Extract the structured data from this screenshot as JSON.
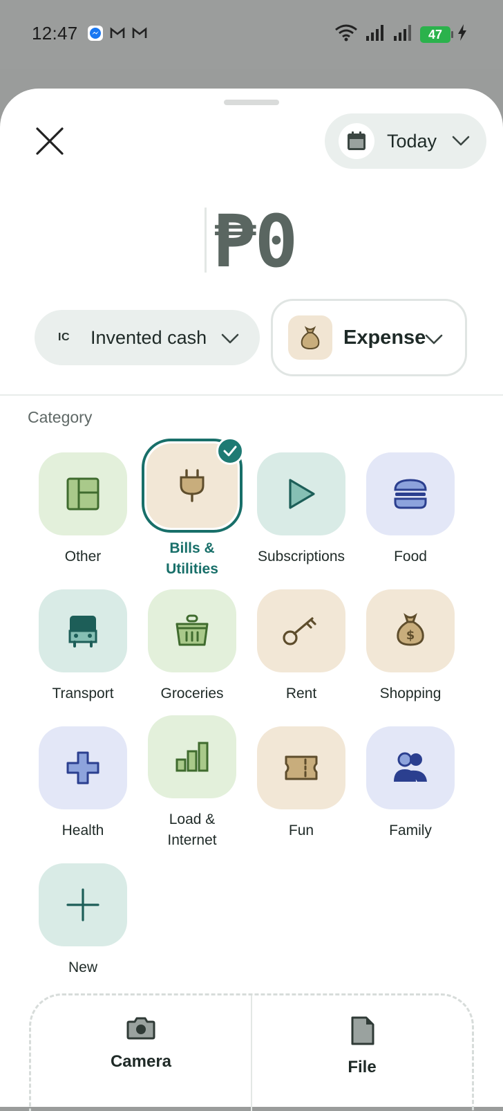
{
  "status_bar": {
    "time": "12:47",
    "battery": "47"
  },
  "header": {
    "date_label": "Today"
  },
  "amount": {
    "value": "₱0"
  },
  "account": {
    "initials": "IC",
    "label": "Invented cash"
  },
  "transaction_type": {
    "label": "Expense"
  },
  "category": {
    "title": "Category",
    "items": [
      {
        "label": "Other",
        "icon": "layout-icon",
        "color": "#e3f0db"
      },
      {
        "label": "Bills &\nUtilities",
        "icon": "plug-icon",
        "color": "#f2e7d6",
        "selected": true
      },
      {
        "label": "Subscriptions",
        "icon": "play-icon",
        "color": "#d9ebe6"
      },
      {
        "label": "Food",
        "icon": "burger-icon",
        "color": "#e3e7f7"
      },
      {
        "label": "Transport",
        "icon": "bus-icon",
        "color": "#d9ebe6"
      },
      {
        "label": "Groceries",
        "icon": "basket-icon",
        "color": "#e3f0db"
      },
      {
        "label": "Rent",
        "icon": "key-icon",
        "color": "#f2e7d6"
      },
      {
        "label": "Shopping",
        "icon": "money-bag-icon",
        "color": "#f2e7d6"
      },
      {
        "label": "Health",
        "icon": "medical-cross-icon",
        "color": "#e3e7f7"
      },
      {
        "label": "Load &\nInternet",
        "icon": "signal-bars-icon",
        "color": "#e3f0db"
      },
      {
        "label": "Fun",
        "icon": "ticket-icon",
        "color": "#f2e7d6"
      },
      {
        "label": "Family",
        "icon": "people-icon",
        "color": "#e3e7f7"
      },
      {
        "label": "New",
        "icon": "plus-icon",
        "color": "#d9ebe6"
      }
    ]
  },
  "attachments": {
    "camera_label": "Camera",
    "file_label": "File"
  },
  "colors": {
    "accent": "#186f69",
    "sheet_bg": "#ffffff",
    "pill_bg": "#eaefed"
  }
}
